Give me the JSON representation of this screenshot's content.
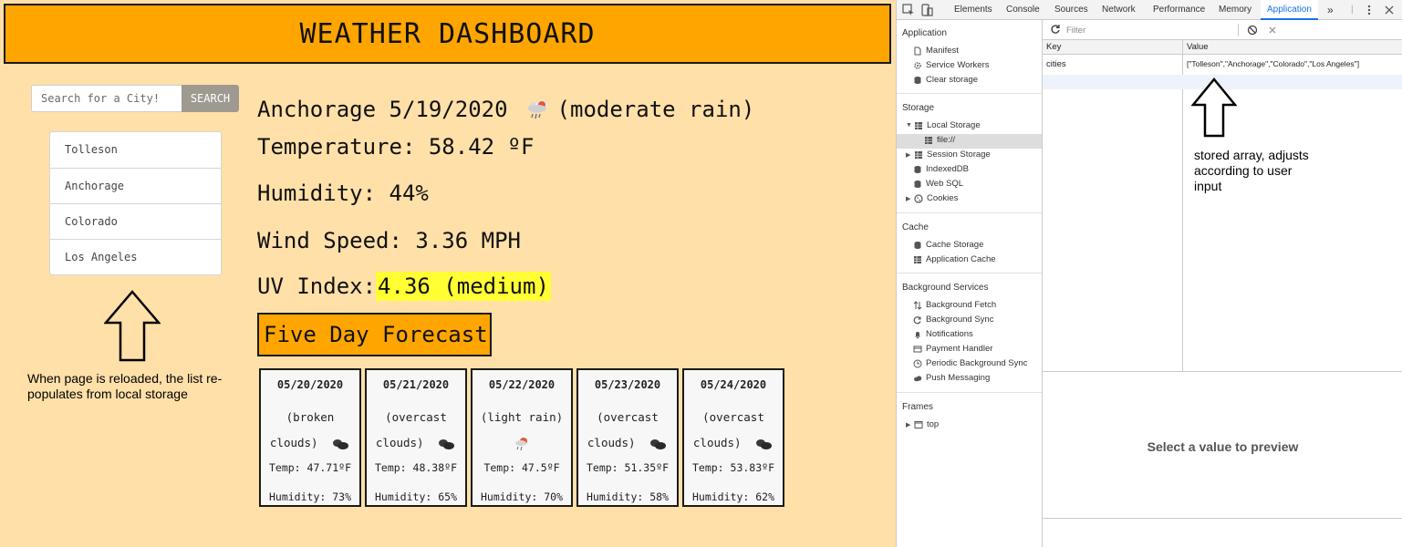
{
  "app": {
    "title": "WEATHER DASHBOARD",
    "search": {
      "placeholder": "Search for a City!",
      "button_label": "SEARCH"
    },
    "history": [
      "Tolleson",
      "Anchorage",
      "Colorado",
      "Los Angeles"
    ],
    "current": {
      "city_date": "Anchorage 5/19/2020",
      "condition": "(moderate rain)",
      "icon": "rain-cloud-icon",
      "temperature": "Temperature: 58.42 ºF",
      "humidity": "Humidity: 44%",
      "wind": "Wind Speed: 3.36 MPH",
      "uv_label": "UV Index:",
      "uv_value": "4.36 (medium)",
      "uv_color": "#ffff33"
    },
    "forecast_title": "Five Day Forecast",
    "forecast": [
      {
        "date": "05/20/2020",
        "desc": "(broken clouds)",
        "icon": "broken-clouds-icon",
        "temp": "Temp: 47.71ºF",
        "humidity": "Humidity: 73%"
      },
      {
        "date": "05/21/2020",
        "desc": "(overcast clouds)",
        "icon": "overcast-clouds-icon",
        "temp": "Temp: 48.38ºF",
        "humidity": "Humidity: 65%"
      },
      {
        "date": "05/22/2020",
        "desc": "(light rain)",
        "icon": "light-rain-icon",
        "temp": "Temp: 47.5ºF",
        "humidity": "Humidity: 70%"
      },
      {
        "date": "05/23/2020",
        "desc": "(overcast clouds)",
        "icon": "overcast-clouds-icon",
        "temp": "Temp: 51.35ºF",
        "humidity": "Humidity: 58%"
      },
      {
        "date": "05/24/2020",
        "desc": "(overcast clouds)",
        "icon": "overcast-clouds-icon",
        "temp": "Temp: 53.83ºF",
        "humidity": "Humidity: 62%"
      }
    ],
    "annotation_left": "When page is reloaded, the list re-populates from local storage",
    "annotation_right": "stored array, adjusts according to user input",
    "colors": {
      "background": "#ffe0a9",
      "accent": "#ffa500"
    }
  },
  "devtools": {
    "tabs": [
      "Elements",
      "Console",
      "Sources",
      "Network",
      "Performance",
      "Memory",
      "Application"
    ],
    "active_tab": "Application",
    "more_tabs": "»",
    "sidebar": {
      "application_header": "Application",
      "application_items": [
        "Manifest",
        "Service Workers",
        "Clear storage"
      ],
      "storage_header": "Storage",
      "storage_items": {
        "local_storage": "Local Storage",
        "local_storage_child": "file://",
        "session_storage": "Session Storage",
        "indexeddb": "IndexedDB",
        "websql": "Web SQL",
        "cookies": "Cookies"
      },
      "cache_header": "Cache",
      "cache_items": [
        "Cache Storage",
        "Application Cache"
      ],
      "background_header": "Background Services",
      "background_items": [
        "Background Fetch",
        "Background Sync",
        "Notifications",
        "Payment Handler",
        "Periodic Background Sync",
        "Push Messaging"
      ],
      "frames_header": "Frames",
      "frames_items": [
        "top"
      ]
    },
    "filter_placeholder": "Filter",
    "table": {
      "headers": [
        "Key",
        "Value"
      ],
      "rows": [
        {
          "key": "cities",
          "value": "[\"Tolleson\",\"Anchorage\",\"Colorado\",\"Los Angeles\"]"
        }
      ]
    },
    "preview_text": "Select a value to preview"
  }
}
